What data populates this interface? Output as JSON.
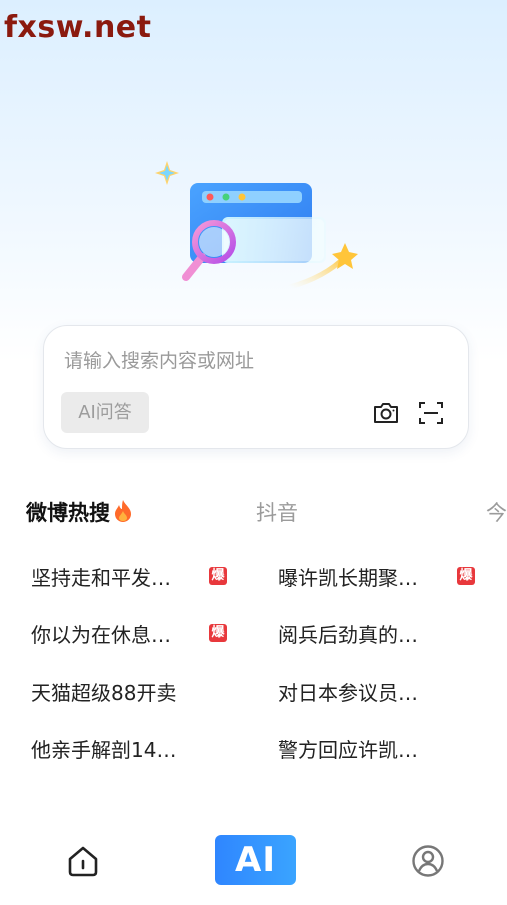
{
  "watermark": "fxsw.net",
  "search": {
    "placeholder": "请输入搜索内容或网址",
    "ai_chip": "AI问答"
  },
  "icons": {
    "camera": "camera-icon",
    "scan": "scan-icon",
    "home": "home-icon",
    "profile": "profile-icon",
    "fire": "fire-icon"
  },
  "tabs": [
    {
      "label": "微博热搜"
    },
    {
      "label": "抖音"
    },
    {
      "label": "今"
    }
  ],
  "hot_list": [
    {
      "text": "坚持走和平发…",
      "badge": "爆"
    },
    {
      "text": "曝许凯长期聚…",
      "badge": "爆"
    },
    {
      "text": "你以为在休息…",
      "badge": "爆"
    },
    {
      "text": "阅兵后劲真的…",
      "badge": ""
    },
    {
      "text": "天猫超级88开卖",
      "badge": ""
    },
    {
      "text": "对日本参议员…",
      "badge": ""
    },
    {
      "text": "他亲手解剖14…",
      "badge": ""
    },
    {
      "text": "警方回应许凯…",
      "badge": ""
    }
  ],
  "bottom_nav": {
    "ai_label": "AI"
  },
  "colors": {
    "accent": "#2f86ff",
    "badge": "#e8383c",
    "watermark": "#8b1a0f"
  }
}
